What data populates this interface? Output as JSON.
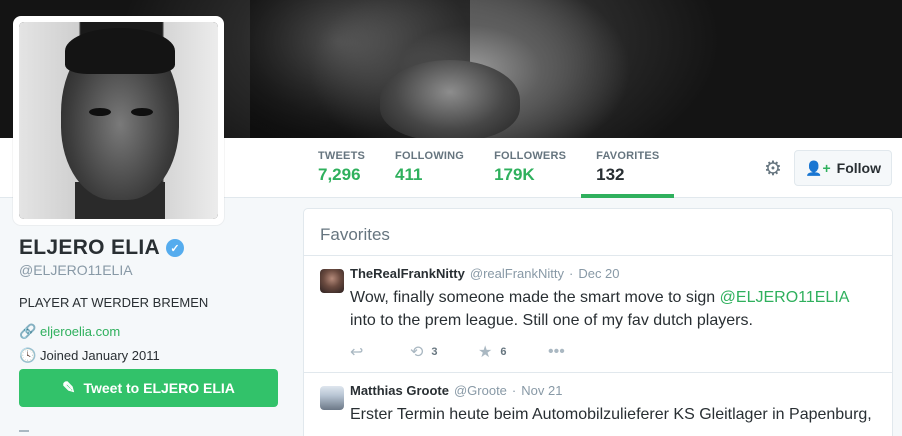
{
  "profile": {
    "name": "ELJERO ELIA",
    "handle": "@ELJERO11ELIA",
    "bio": "PLAYER AT WERDER BREMEN",
    "website": "eljeroelia.com",
    "joined": "Joined January 2011",
    "tweet_to_label": "Tweet to ELJERO ELIA",
    "verified": true
  },
  "stats": [
    {
      "label": "TWEETS",
      "value": "7,296"
    },
    {
      "label": "FOLLOWING",
      "value": "411"
    },
    {
      "label": "FOLLOWERS",
      "value": "179K"
    },
    {
      "label": "FAVORITES",
      "value": "132"
    }
  ],
  "follow_label": "Follow",
  "stream": {
    "title": "Favorites",
    "tweets": [
      {
        "fullname": "TheRealFrankNitty",
        "screen": "@realFrankNitty",
        "time": "Dec 20",
        "text_before": "Wow, finally someone made the smart move to sign ",
        "mention": "@ELJERO11ELIA",
        "text_after": " into to the prem league. Still one of my fav dutch players.",
        "retweets": "3",
        "favorites": "6"
      },
      {
        "fullname": "Matthias Groote",
        "screen": "@Groote",
        "time": "Nov 21",
        "text": "Erster Termin heute beim Automobilzulieferer KS Gleitlager in Papenburg,"
      }
    ]
  },
  "colors": {
    "accent": "#2fb05d",
    "button": "#32c26a",
    "verified": "#55acee",
    "muted": "#8899a6"
  },
  "icons": {
    "gear": "gear-icon",
    "follow": "add-user-icon",
    "link": "link-icon",
    "calendar": "clock-icon",
    "compose": "quill-icon",
    "reply": "reply-icon",
    "retweet": "retweet-icon",
    "favorite": "star-icon",
    "more": "more-icon"
  }
}
